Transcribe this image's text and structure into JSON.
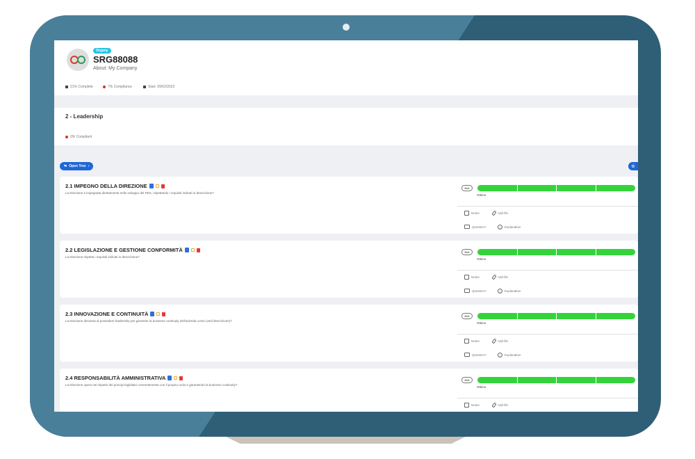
{
  "organization": {
    "badge": "Organy",
    "code": "SRG88088",
    "about": "About: My Company",
    "logo_icon": "company-logo"
  },
  "stats": {
    "complete": "21% Complete",
    "compliance": "7% Compliance",
    "start": "Start: 09/02/2022"
  },
  "section": {
    "title": "2 - Leadership",
    "compliant": "0% Compliant"
  },
  "toolbar": {
    "open_tree_label": "Open Tree"
  },
  "items": [
    {
      "title": "2.1 IMPEGNO DELLA DIREZIONE",
      "description": "La Direzione è impegnata direttamente nello sviluppo del PES, rispettando i requisiti indicati in descrizione?",
      "na": "N/A",
      "rating": "Ottimo",
      "notes": "Notes",
      "add_file": "Add file",
      "question": "Question?",
      "explanation": "Explanation"
    },
    {
      "title": "2.2 LEGISLAZIONE E GESTIONE CONFORMITÀ",
      "description": "La Direzione rispetta i requisiti indicati in descrizione?",
      "na": "N/A",
      "rating": "Ottimo",
      "notes": "Notes",
      "add_file": "Add file",
      "question": "Question?",
      "explanation": "Explanation"
    },
    {
      "title": "2.3 INNOVAZIONE E CONTINUITÀ",
      "description": "La Direzione dimostra di possedere leadership per garantire la business continuity dell'azienda come (vedi descrizione)?",
      "na": "N/A",
      "rating": "Ottimo",
      "notes": "Notes",
      "add_file": "Add file",
      "question": "Question?",
      "explanation": "Explanation"
    },
    {
      "title": "2.4 RESPONSABILITÀ AMMINISTRATIVA",
      "description": "La Direzione opera nel rispetto dei principi legislativi coerentemente con il proprio ruolo e garantendo la business continuity?",
      "na": "N/A",
      "rating": "Ottimo",
      "notes": "Notes",
      "add_file": "Add file"
    }
  ],
  "colors": {
    "bezel": "#2f5f77",
    "accent_blue": "#1f67d8",
    "badge_cyan": "#21c4e6",
    "progress_green": "#33d43a",
    "status_red": "#d32f2f"
  }
}
